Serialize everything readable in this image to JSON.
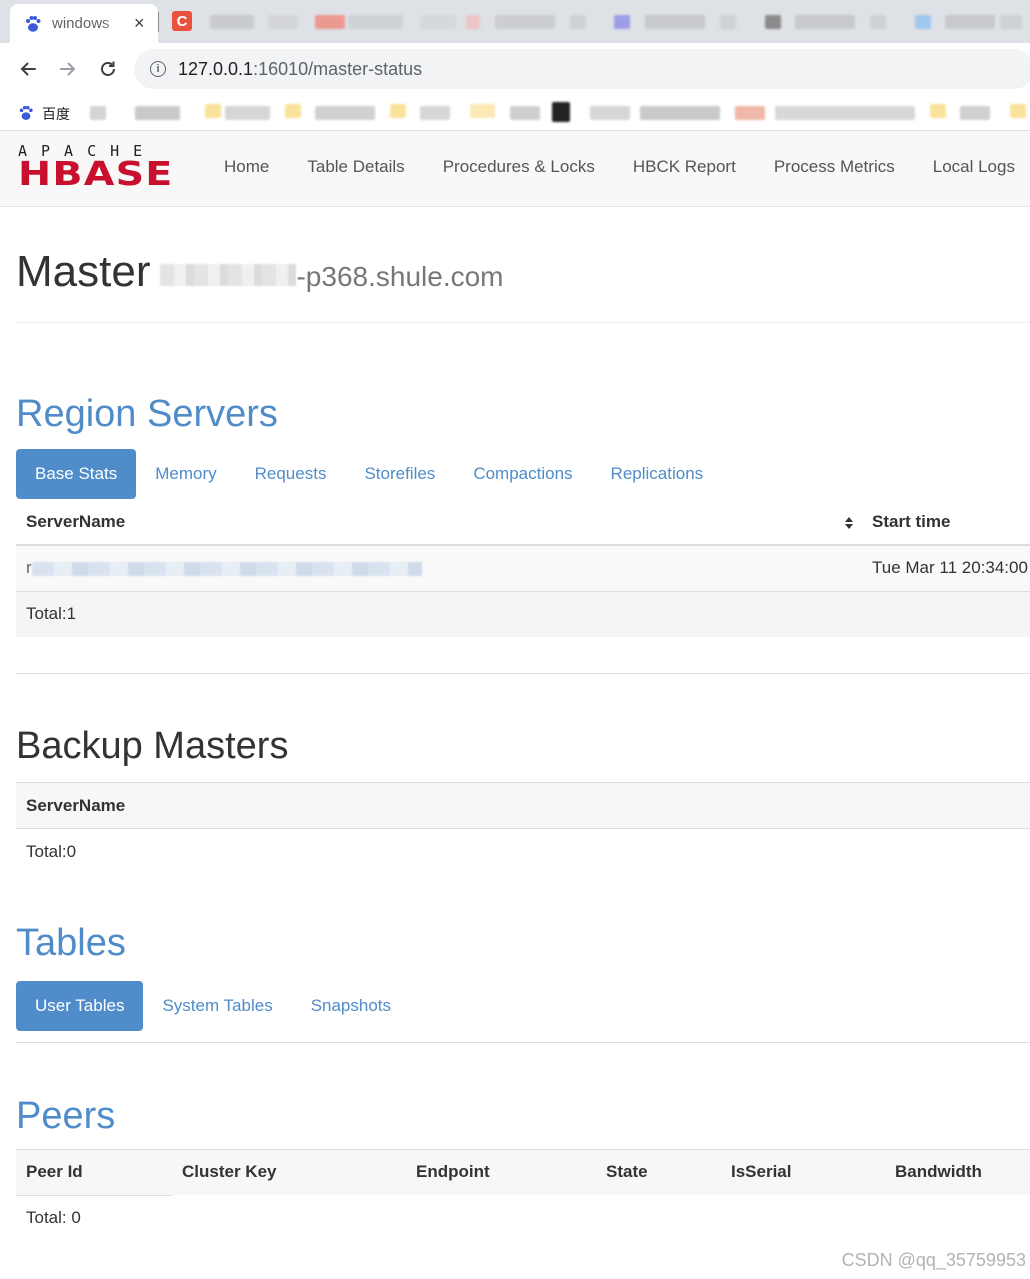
{
  "browser": {
    "active_tab_title": "windows",
    "tab_close": "×",
    "second_tab_letter": "C",
    "url_host": "127.0.0.1",
    "url_rest": ":16010/master-status",
    "bookmark_first_label": "百度"
  },
  "nav": {
    "logo_top": "APACHE",
    "logo_main": "HBASE",
    "links": [
      "Home",
      "Table Details",
      "Procedures & Locks",
      "HBCK Report",
      "Process Metrics",
      "Local Logs"
    ]
  },
  "master": {
    "title": "Master",
    "hostname_visible": "-p368.shule.com"
  },
  "region_servers": {
    "heading": "Region Servers",
    "tabs": [
      "Base Stats",
      "Memory",
      "Requests",
      "Storefiles",
      "Compactions",
      "Replications"
    ],
    "active_tab": "Base Stats",
    "columns": [
      "ServerName",
      "Start time"
    ],
    "sort_icon": "sort-icon",
    "rows": [
      {
        "server_prefix": "r",
        "start_time": "Tue Mar 11 20:34:00"
      }
    ],
    "total": "Total:1"
  },
  "backup_masters": {
    "heading": "Backup Masters",
    "columns": [
      "ServerName"
    ],
    "total": "Total:0"
  },
  "tables": {
    "heading": "Tables",
    "tabs": [
      "User Tables",
      "System Tables",
      "Snapshots"
    ],
    "active_tab": "User Tables"
  },
  "peers": {
    "heading": "Peers",
    "columns": [
      "Peer Id",
      "Cluster Key",
      "Endpoint",
      "State",
      "IsSerial",
      "Bandwidth"
    ],
    "total": "Total: 0"
  },
  "watermark": "CSDN @qq_35759953",
  "colors": {
    "accent": "#4f8cc9",
    "hbase_red": "#c8102e",
    "navbar_bg": "#f8f8f8"
  }
}
